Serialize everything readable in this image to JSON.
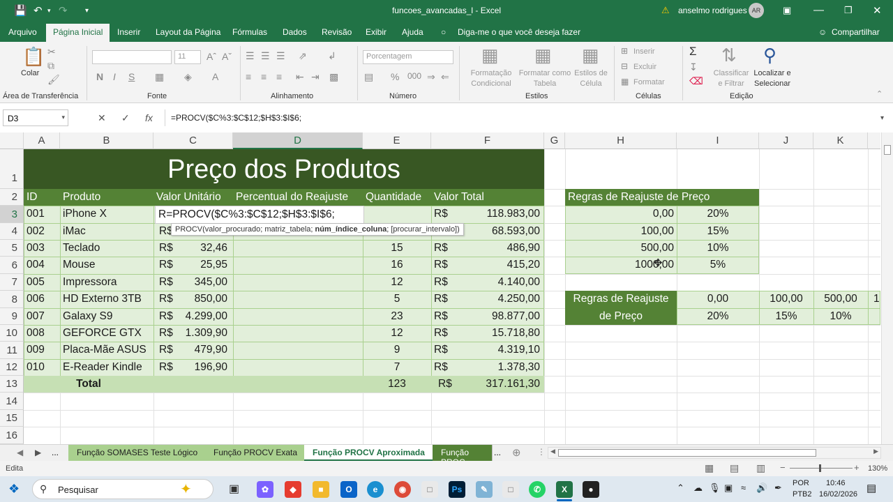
{
  "titlebar": {
    "title": "funcoes_avancadas_l  -  Excel",
    "user": "anselmo rodrigues",
    "initials": "AR"
  },
  "menu": [
    "Arquivo",
    "Página Inicial",
    "Inserir",
    "Layout da Página",
    "Fórmulas",
    "Dados",
    "Revisão",
    "Exibir",
    "Ajuda"
  ],
  "tellme": "Diga-me o que você deseja fazer",
  "share": "Compartilhar",
  "ribbon": {
    "paste": "Colar",
    "clipboard": "Área de Transferência",
    "font_group": "Fonte",
    "font_size": "11",
    "align_group": "Alinhamento",
    "number_format": "Porcentagem",
    "number_group": "Número",
    "cond_format": "Formatação Condicional",
    "format_table": "Formatar como Tabela",
    "cell_styles": "Estilos de Célula",
    "styles_group": "Estilos",
    "insert": "Inserir",
    "delete": "Excluir",
    "format": "Formatar",
    "cells_group": "Células",
    "sort_filter": "Classificar e Filtrar",
    "find_select": "Localizar e Selecionar",
    "edit_group": "Edição"
  },
  "formula_bar": {
    "namebox": "D3",
    "formula": "=PROCV($C%3:$C$12;$H$3:$I$6;"
  },
  "columns": [
    "A",
    "B",
    "C",
    "D",
    "E",
    "F",
    "G",
    "H",
    "I",
    "J",
    "K"
  ],
  "rows": [
    "1",
    "2",
    "3",
    "4",
    "5",
    "6",
    "7",
    "8",
    "9",
    "10",
    "11",
    "12",
    "13",
    "14",
    "15",
    "16"
  ],
  "sheet": {
    "title": "Preço dos Produtos",
    "headers": {
      "id": "ID",
      "product": "Produto",
      "unit_value": "Valor Unitário",
      "percent": "Percentual do Reajuste",
      "quantity": "Quantidade",
      "total_value": "Valor Total"
    },
    "currency": "R$",
    "products": [
      {
        "id": "001",
        "name": "iPhone X",
        "price": "",
        "qty": "",
        "total": "118.983,00"
      },
      {
        "id": "002",
        "name": "iMac",
        "price": "",
        "qty": "",
        "total": "68.593,00"
      },
      {
        "id": "003",
        "name": "Teclado",
        "price": "32,46",
        "qty": "15",
        "total": "486,90"
      },
      {
        "id": "004",
        "name": "Mouse",
        "price": "25,95",
        "qty": "16",
        "total": "415,20"
      },
      {
        "id": "005",
        "name": "Impressora",
        "price": "345,00",
        "qty": "12",
        "total": "4.140,00"
      },
      {
        "id": "006",
        "name": "HD Externo 3TB",
        "price": "850,00",
        "qty": "5",
        "total": "4.250,00"
      },
      {
        "id": "007",
        "name": "Galaxy S9",
        "price": "4.299,00",
        "qty": "23",
        "total": "98.877,00"
      },
      {
        "id": "008",
        "name": "GEFORCE GTX",
        "price": "1.309,90",
        "qty": "12",
        "total": "15.718,80"
      },
      {
        "id": "009",
        "name": "Placa-Mãe ASUS",
        "price": "479,90",
        "qty": "9",
        "total": "4.319,10"
      },
      {
        "id": "010",
        "name": "E-Reader Kindle",
        "price": "196,90",
        "qty": "7",
        "total": "1.378,30"
      }
    ],
    "editing_cell": "R=PROCV($C%3:$C$12;$H$3:$I$6;",
    "row4_partial": "R$",
    "total_label": "Total",
    "total_qty": "123",
    "total_value": "317.161,30",
    "rules_title": "Regras de Reajuste de Preço",
    "rules": [
      {
        "value": "0,00",
        "pct": "20%"
      },
      {
        "value": "100,00",
        "pct": "15%"
      },
      {
        "value": "500,00",
        "pct": "10%"
      },
      {
        "value": "1000,00",
        "pct": "5%"
      }
    ],
    "h_rules_title_1": "Regras de Reajuste",
    "h_rules_title_2": "de Preço",
    "h_values": [
      "0,00",
      "100,00",
      "500,00",
      "1"
    ],
    "h_pcts": [
      "20%",
      "15%",
      "10%"
    ]
  },
  "tooltip": {
    "prefix": "PROCV(valor_procurado; matriz_tabela; ",
    "bold": "núm_índice_coluna",
    "suffix": "; [procurar_intervalo])"
  },
  "sheet_tabs": {
    "ellipsis": "...",
    "tab1": "Função SOMASES Teste Lógico",
    "tab2": "Função PROCV Exata",
    "tab3": "Função PROCV Aproximada",
    "tab4": "Função PROC"
  },
  "status": {
    "mode": "Edita",
    "zoom": "130%"
  },
  "taskbar": {
    "search": "Pesquisar",
    "lang1": "POR",
    "lang2": "PTB2",
    "time": "10:46",
    "date": "16/02/2026"
  },
  "colors": {
    "excel_green": "#217346",
    "band_dark": "#385723",
    "band_mid": "#548235",
    "band_light": "#e2efda"
  }
}
